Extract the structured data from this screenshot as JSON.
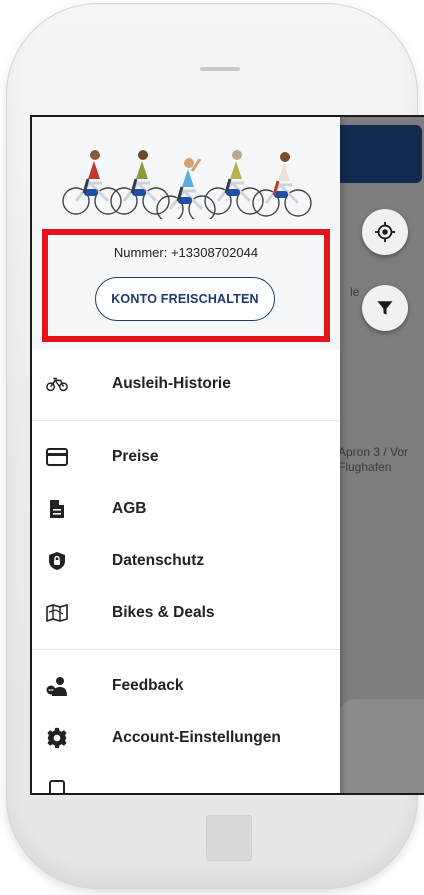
{
  "user": {
    "number_label": "Nummer: +13308702044",
    "unlock_button_label": "KONTO FREISCHALTEN"
  },
  "menu": {
    "group1": [
      {
        "label": "Ausleih-Historie",
        "icon": "bike-icon"
      }
    ],
    "group2": [
      {
        "label": "Preise",
        "icon": "credit-card-icon"
      },
      {
        "label": "AGB",
        "icon": "document-icon"
      },
      {
        "label": "Datenschutz",
        "icon": "shield-lock-icon"
      },
      {
        "label": "Bikes & Deals",
        "icon": "map-icon"
      }
    ],
    "group3": [
      {
        "label": "Feedback",
        "icon": "feedback-icon"
      },
      {
        "label": "Account-Einstellungen",
        "icon": "gear-icon"
      }
    ]
  },
  "map": {
    "partial_label_1": "le",
    "partial_label_2a": "Apron 3 / Vor",
    "partial_label_2b": "Flughafen"
  },
  "colors": {
    "brand_navy": "#1d3a6a",
    "highlight_red": "#e5121b",
    "map_header": "#102a50"
  }
}
